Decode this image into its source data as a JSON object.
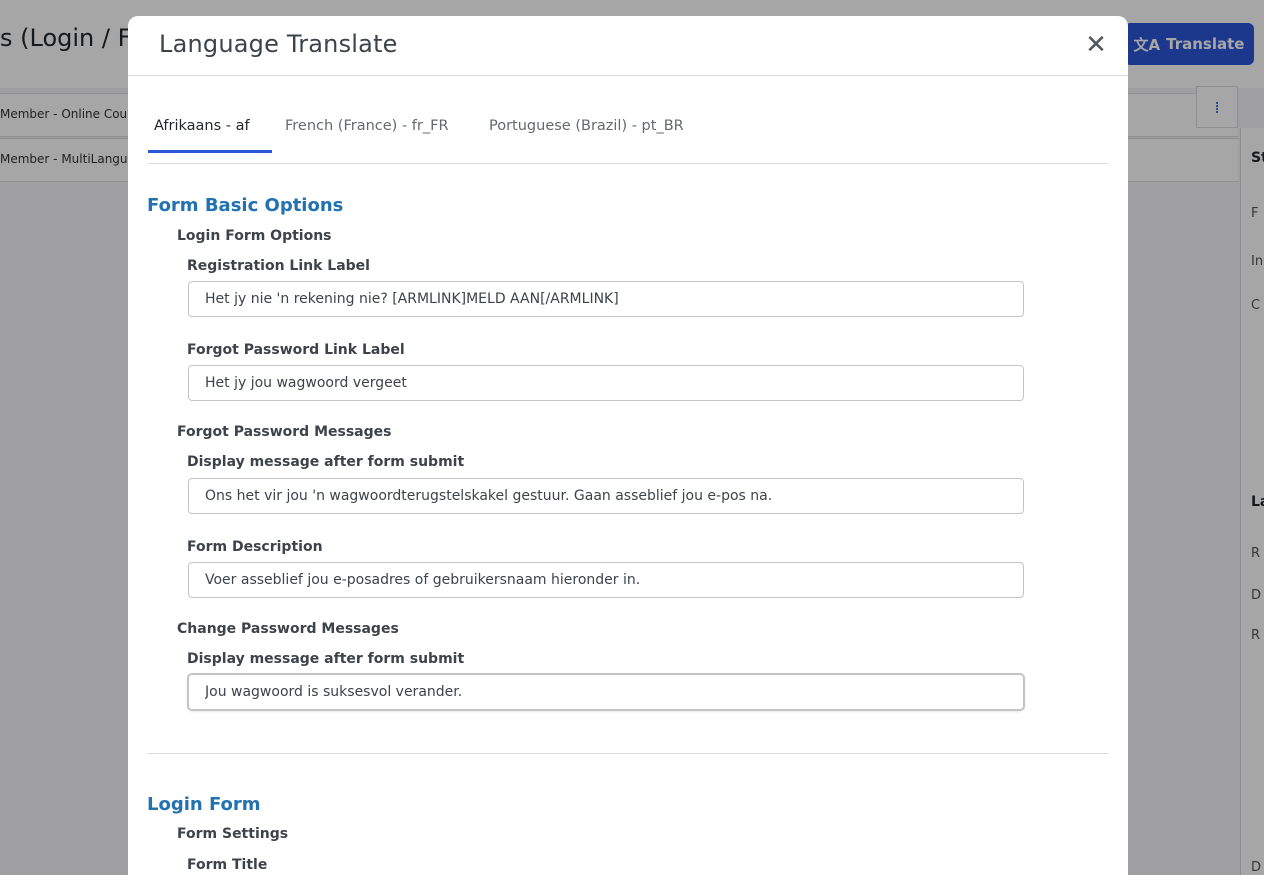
{
  "background": {
    "page_title": "s (Login / Fo",
    "translate_button": {
      "icon": "translate-icon",
      "label": "Translate"
    },
    "rows": [
      "Member - Online Cou",
      "Member - MultiLangu"
    ],
    "side_button_icon": "drag-dots-icon",
    "right_panel": [
      "St",
      "F",
      "In",
      "C",
      "La",
      "R",
      "D",
      "R",
      "D"
    ]
  },
  "modal": {
    "title": "Language Translate",
    "close_icon": "close-icon",
    "tabs": [
      {
        "label": "Afrikaans - af"
      },
      {
        "label": "French (France) - fr_FR"
      },
      {
        "label": "Portuguese (Brazil) - pt_BR"
      }
    ],
    "sections": {
      "basic": {
        "title": "Form Basic Options",
        "login_form_options": {
          "title": "Login Form Options",
          "registration_link": {
            "label": "Registration Link Label",
            "value": "Het jy nie 'n rekening nie? [ARMLINK]MELD AAN[/ARMLINK]"
          },
          "forgot_password_link": {
            "label": "Forgot Password Link Label",
            "value": "Het jy jou wagwoord vergeet"
          }
        },
        "forgot_password_messages": {
          "title": "Forgot Password Messages",
          "display_message": {
            "label": "Display message after form submit",
            "value": "Ons het vir jou 'n wagwoordterugstelskakel gestuur. Gaan asseblief jou e-pos na."
          },
          "form_description": {
            "label": "Form Description",
            "value": "Voer asseblief jou e-posadres of gebruikersnaam hieronder in."
          }
        },
        "change_password_messages": {
          "title": "Change Password Messages",
          "display_message": {
            "label": "Display message after form submit",
            "value": "Jou wagwoord is suksesvol verander."
          }
        }
      },
      "login_form": {
        "title": "Login Form",
        "form_settings": {
          "title": "Form Settings",
          "form_title_label": "Form Title"
        }
      }
    }
  },
  "colors": {
    "accent": "#2b56d8",
    "section_title": "#2271b1",
    "overlay": "rgba(0,0,0,0.35)"
  }
}
